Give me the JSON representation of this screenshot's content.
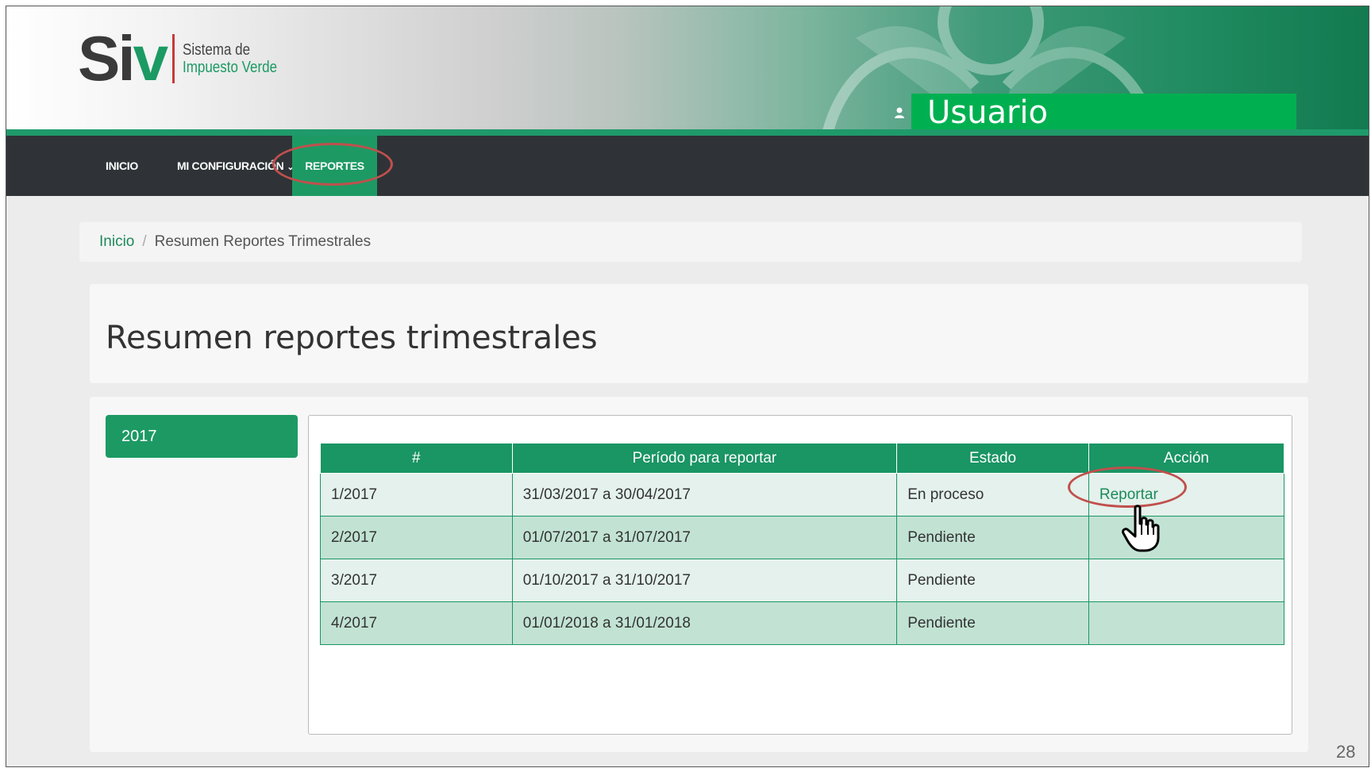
{
  "header": {
    "logo_s": "S",
    "logo_i": "i",
    "logo_v": "v",
    "logo_text_line1": "Sistema de",
    "logo_text_line2": "Impuesto Verde",
    "user_label": "Usuario"
  },
  "nav": {
    "inicio": "INICIO",
    "mi_configuracion": "MI CONFIGURACIÓN",
    "reportes": "REPORTES",
    "active": "REPORTES"
  },
  "breadcrumb": {
    "home": "Inicio",
    "separator": "/",
    "current": "Resumen Reportes Trimestrales"
  },
  "page": {
    "title": "Resumen reportes trimestrales",
    "year_tab": "2017"
  },
  "table": {
    "headers": [
      "#",
      "Período para reportar",
      "Estado",
      "Acción"
    ],
    "rows": [
      {
        "num": "1/2017",
        "period": "31/03/2017 a 30/04/2017",
        "status": "En proceso",
        "action": "Reportar"
      },
      {
        "num": "2/2017",
        "period": "01/07/2017 a 31/07/2017",
        "status": "Pendiente",
        "action": ""
      },
      {
        "num": "3/2017",
        "period": "01/10/2017 a 31/10/2017",
        "status": "Pendiente",
        "action": ""
      },
      {
        "num": "4/2017",
        "period": "01/01/2018 a 31/01/2018",
        "status": "Pendiente",
        "action": ""
      }
    ]
  },
  "slide": {
    "page_number": "28"
  },
  "colors": {
    "brand_green": "#1d9a64",
    "user_green": "#00b050",
    "nav_dark": "#2f3337",
    "highlight_red": "#c0504d"
  }
}
